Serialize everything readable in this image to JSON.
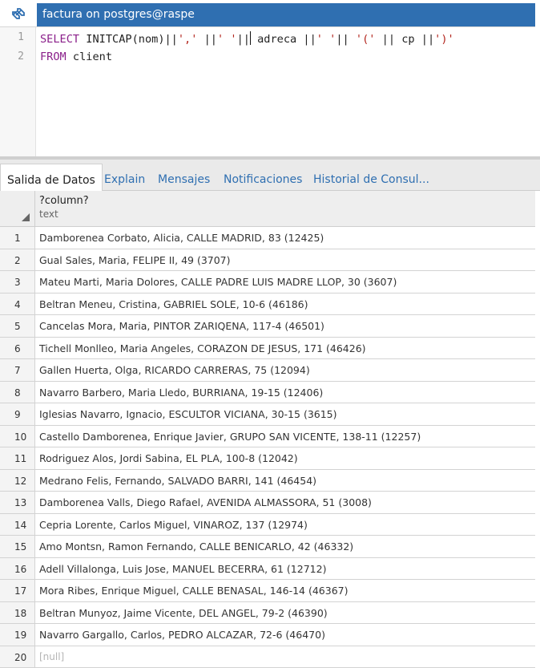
{
  "window": {
    "title": "factura on postgres@raspe",
    "icon": "link-icon"
  },
  "editor": {
    "line_numbers": [
      "1",
      "2"
    ],
    "line1": {
      "kw_select": "SELECT",
      "t1": " INITCAP(nom)||",
      "s1": "','",
      "t2": " ||",
      "s2": "' '",
      "t3": "||",
      "t4": " adreca ||",
      "s3": "' '",
      "t5": "|| ",
      "s4": "'('",
      "t6": " || cp ||",
      "s5": "')'"
    },
    "line2": {
      "kw_from": "FROM",
      "t1": " client"
    }
  },
  "result_tabs": [
    {
      "label": "Salida de Datos",
      "active": true
    },
    {
      "label": "Explain"
    },
    {
      "label": "Mensajes"
    },
    {
      "label": "Notificaciones"
    },
    {
      "label": "Historial de Consul..."
    }
  ],
  "grid": {
    "column": {
      "name": "?column?",
      "type": "text"
    },
    "rows": [
      {
        "n": "1",
        "v": "Damborenea Corbato, Alicia, CALLE MADRID, 83 (12425)"
      },
      {
        "n": "2",
        "v": "Gual Sales, Maria, FELIPE II, 49 (3707)"
      },
      {
        "n": "3",
        "v": "Mateu Marti, Maria Dolores, CALLE PADRE LUIS MADRE LLOP, 30 (3607)"
      },
      {
        "n": "4",
        "v": "Beltran Meneu, Cristina, GABRIEL SOLE, 10-6 (46186)"
      },
      {
        "n": "5",
        "v": "Cancelas Mora, Maria, PINTOR ZARIQENA, 117-4 (46501)"
      },
      {
        "n": "6",
        "v": "Tichell Monlleo, Maria Angeles, CORAZON DE JESUS, 171 (46426)"
      },
      {
        "n": "7",
        "v": "Gallen Huerta, Olga, RICARDO CARRERAS, 75 (12094)"
      },
      {
        "n": "8",
        "v": "Navarro Barbero, Maria Lledo, BURRIANA, 19-15 (12406)"
      },
      {
        "n": "9",
        "v": "Iglesias Navarro, Ignacio, ESCULTOR VICIANA, 30-15 (3615)"
      },
      {
        "n": "10",
        "v": "Castello Damborenea, Enrique Javier, GRUPO SAN VICENTE, 138-11 (12257)"
      },
      {
        "n": "11",
        "v": "Rodriguez Alos, Jordi Sabina, EL PLA, 100-8 (12042)"
      },
      {
        "n": "12",
        "v": "Medrano Felis, Fernando, SALVADO BARRI, 141 (46454)"
      },
      {
        "n": "13",
        "v": "Damborenea Valls, Diego Rafael, AVENIDA ALMASSORA, 51 (3008)"
      },
      {
        "n": "14",
        "v": "Cepria Lorente, Carlos Miguel, VINAROZ, 137 (12974)"
      },
      {
        "n": "15",
        "v": "Amo Montsn, Ramon Fernando, CALLE BENICARLO, 42 (46332)"
      },
      {
        "n": "16",
        "v": "Adell Villalonga, Luis Jose, MANUEL BECERRA, 61 (12712)"
      },
      {
        "n": "17",
        "v": "Mora Ribes, Enrique Miguel, CALLE BENASAL, 146-14 (46367)"
      },
      {
        "n": "18",
        "v": "Beltran Munyoz, Jaime Vicente, DEL ANGEL, 79-2 (46390)"
      },
      {
        "n": "19",
        "v": "Navarro Gargallo, Carlos, PEDRO ALCAZAR, 72-6 (46470)"
      },
      {
        "n": "20",
        "v": "[null]"
      }
    ]
  },
  "colors": {
    "title_tab_bg": "#2f6fb1",
    "keyword": "#8a1f8a",
    "string": "#b3261e",
    "link_tab": "#2f6fb1"
  }
}
